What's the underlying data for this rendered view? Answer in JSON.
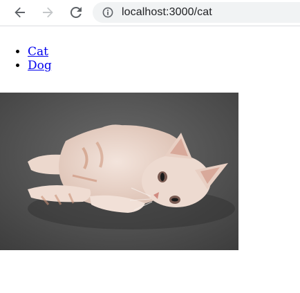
{
  "browser": {
    "url": "localhost:3000/cat",
    "icons": {
      "back": "arrow-left-icon",
      "forward": "arrow-right-icon",
      "reload": "reload-icon",
      "site_info": "info-circle-icon"
    }
  },
  "page": {
    "links": [
      {
        "label": "Cat"
      },
      {
        "label": "Dog"
      }
    ],
    "image": {
      "subject": "kitten",
      "colors": {
        "background": "#4d4d4d",
        "fur": "#e8d2c8",
        "fur_stripe": "#d9a98d"
      }
    }
  },
  "colors": {
    "link": "#0000ee",
    "omnibox_bg": "#f1f3f4",
    "url_text": "#202124",
    "icon": "#5f6368"
  }
}
